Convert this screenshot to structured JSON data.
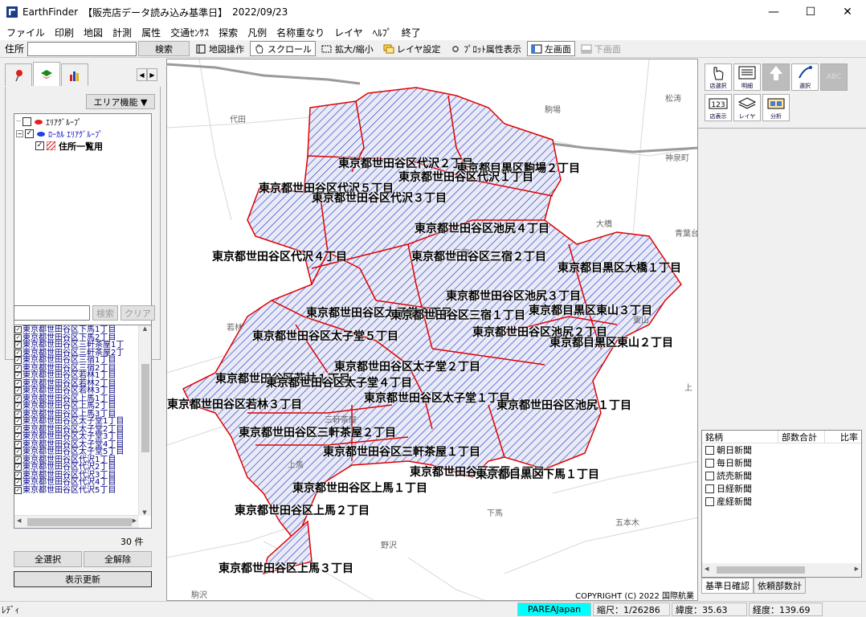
{
  "window": {
    "app_name": "EarthFinder",
    "doc_title": "【販売店データ読み込み基準日】",
    "date": "2022/09/23",
    "minimize": "—",
    "maximize": "☐",
    "close": "✕"
  },
  "menu": [
    "ファイル",
    "印刷",
    "地図",
    "計測",
    "属性",
    "交通ｾﾝｻｽ",
    "探索",
    "凡例",
    "名称重なり",
    "レイヤ",
    "ﾍﾙﾌﾟ",
    "終了"
  ],
  "toolbar": {
    "address_label": "住所",
    "address_value": "",
    "search": "検索",
    "map_op": "地図操作",
    "scroll": "スクロール",
    "zoom": "拡大/縮小",
    "layer_settings": "レイヤ設定",
    "plot_attr": "ﾌﾟﾛｯﾄ属性表示",
    "left_screen": "左画面",
    "bottom_screen": "下画面"
  },
  "left_panel": {
    "area_function": "エリア機能 ▼",
    "tree": [
      {
        "label": "ｴﾘｱｸﾞﾙｰﾌﾟ",
        "checked": false
      },
      {
        "label": "ﾛｰｶﾙ ｴﾘｱｸﾞﾙｰﾌﾟ",
        "checked": true
      },
      {
        "label": "住所一覧用",
        "checked": true
      }
    ],
    "search_value": "",
    "search_btn": "検索",
    "clear_btn": "クリア",
    "address_list": [
      "東京都世田谷区下馬1丁目",
      "東京都世田谷区下馬2丁目",
      "東京都世田谷区三軒茶屋1丁",
      "東京都世田谷区三軒茶屋2丁",
      "東京都世田谷区三宿1丁目",
      "東京都世田谷区三宿2丁目",
      "東京都世田谷区若林1丁目",
      "東京都世田谷区若林2丁目",
      "東京都世田谷区若林3丁目",
      "東京都世田谷区上馬1丁目",
      "東京都世田谷区上馬2丁目",
      "東京都世田谷区上馬3丁目",
      "東京都世田谷区太子堂1丁目",
      "東京都世田谷区太子堂2丁目",
      "東京都世田谷区太子堂3丁目",
      "東京都世田谷区太子堂4丁目",
      "東京都世田谷区太子堂5丁目",
      "東京都世田谷区代沢1丁目",
      "東京都世田谷区代沢2丁目",
      "東京都世田谷区代沢3丁目",
      "東京都世田谷区代沢4丁目",
      "東京都世田谷区代沢5丁目"
    ],
    "count": "30 件",
    "select_all": "全選択",
    "deselect_all": "全解除",
    "refresh": "表示更新"
  },
  "map": {
    "copyright": "COPYRIGHT (C) 2022 国際航業",
    "labels": [
      {
        "text": "東京都世田谷区代沢２丁目"
      },
      {
        "text": "東京都目黒区駒場２丁目"
      },
      {
        "text": "東京都世田谷区代沢１丁目"
      },
      {
        "text": "東京都世田谷区代沢５丁目"
      },
      {
        "text": "東京都世田谷区代沢３丁目"
      },
      {
        "text": "東京都世田谷区池尻４丁目"
      },
      {
        "text": "東京都世田谷区代沢４丁目"
      },
      {
        "text": "東京都世田谷区三宿２丁目"
      },
      {
        "text": "東京都目黒区大橋１丁目"
      },
      {
        "text": "東京都世田谷区池尻３丁目"
      },
      {
        "text": "東京都世田谷区太子堂３丁目"
      },
      {
        "text": "東京都世田谷区三宿１丁目"
      },
      {
        "text": "東京都目黒区東山３丁目"
      },
      {
        "text": "東京都世田谷区太子堂５丁目"
      },
      {
        "text": "東京都世田谷区池尻２丁目"
      },
      {
        "text": "東京都目黒区東山２丁目"
      },
      {
        "text": "東京都世田谷区太子堂２丁目"
      },
      {
        "text": "東京都世田谷区若林１丁目"
      },
      {
        "text": "東京都世田谷区太子堂４丁目"
      },
      {
        "text": "東京都世田谷区太子堂１丁目"
      },
      {
        "text": "東京都世田谷区池尻１丁目"
      },
      {
        "text": "東京都世田谷区若林３丁目"
      },
      {
        "text": "東京都世田谷区三軒茶屋２丁目"
      },
      {
        "text": "東京都世田谷区三軒茶屋１丁目"
      },
      {
        "text": "東京都世田谷区下馬２丁目"
      },
      {
        "text": "東京都目黒区下馬１丁目"
      },
      {
        "text": "東京都世田谷区上馬１丁目"
      },
      {
        "text": "東京都世田谷区上馬２丁目"
      },
      {
        "text": "東京都世田谷区上馬３丁目"
      }
    ],
    "place_names": [
      {
        "text": "駒場"
      },
      {
        "text": "代田"
      },
      {
        "text": "松涛"
      },
      {
        "text": "神泉町"
      },
      {
        "text": "大橋"
      },
      {
        "text": "青葉台"
      },
      {
        "text": "若林"
      },
      {
        "text": "下馬"
      },
      {
        "text": "五本木"
      },
      {
        "text": "野沢"
      },
      {
        "text": "駒沢"
      },
      {
        "text": "上"
      },
      {
        "text": "東山"
      },
      {
        "text": "上馬"
      },
      {
        "text": "三宿"
      },
      {
        "text": "三軒茶屋"
      }
    ]
  },
  "right_panel": {
    "tools": [
      {
        "label": "店選択"
      },
      {
        "label": "明細"
      },
      {
        "label": "Ｑ"
      },
      {
        "label": "選択"
      },
      {
        "label": "ABC"
      },
      {
        "label": "店表示"
      },
      {
        "label": "レイヤ"
      },
      {
        "label": "分析"
      }
    ],
    "table_headers": [
      "銘柄",
      "部数合計",
      "比率"
    ],
    "newspapers": [
      "朝日新聞",
      "毎日新聞",
      "読売新聞",
      "日経新聞",
      "産経新聞"
    ],
    "tab_base_date": "基準日確認",
    "tab_request": "依頼部数計"
  },
  "status": {
    "ready": "ﾚﾃﾞｨ",
    "provider": "PAREAJapan",
    "scale": "縮尺：1/26286",
    "lat": "緯度：35.63",
    "lon": "経度：139.69"
  }
}
